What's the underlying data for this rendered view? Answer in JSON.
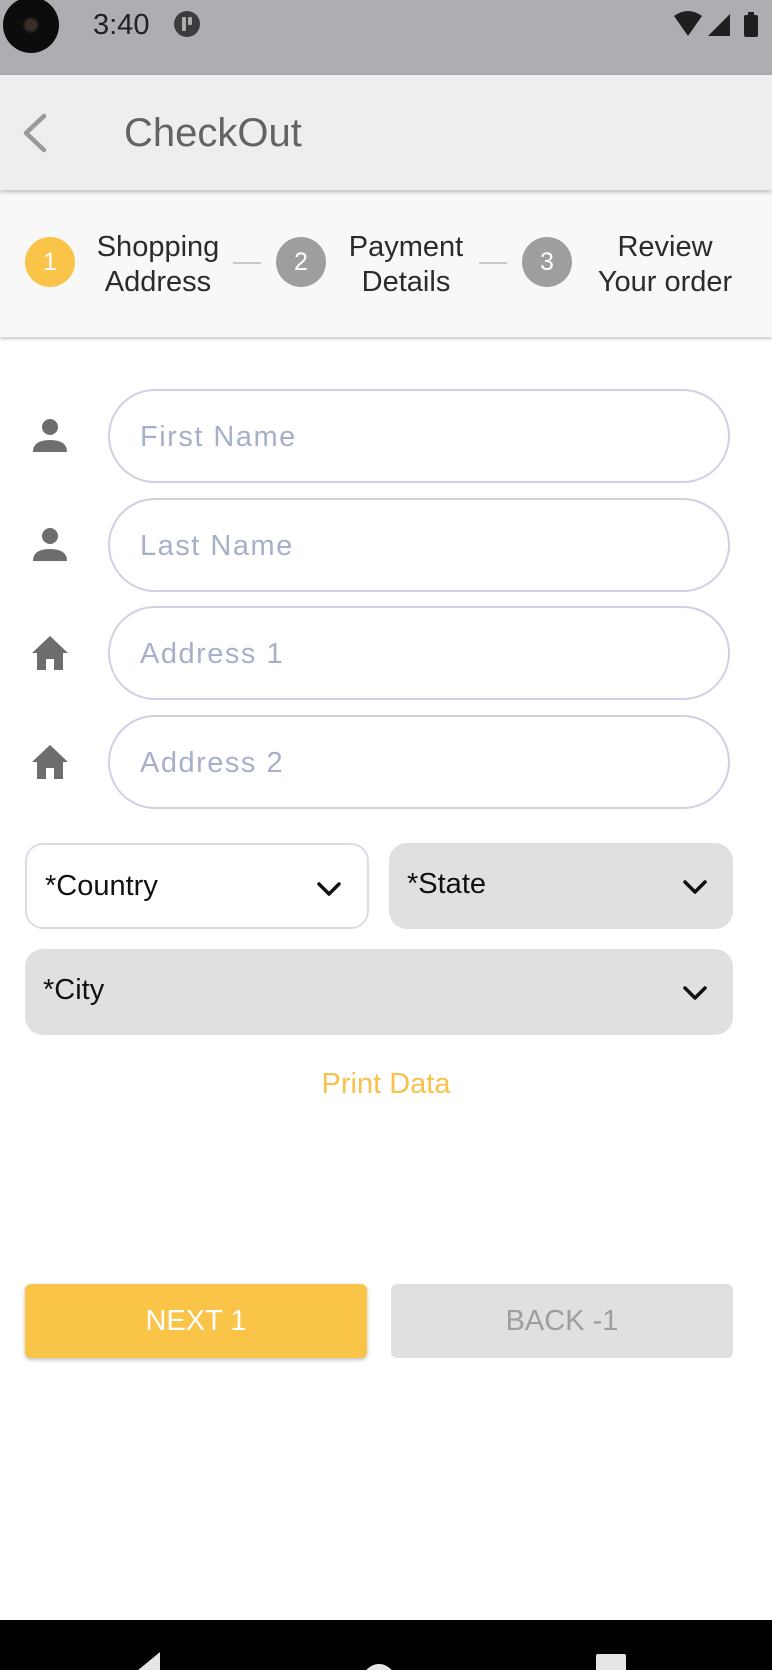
{
  "status_bar": {
    "time": "3:40",
    "icons": [
      "camera-dot-icon",
      "app-notification-icon",
      "wifi-icon",
      "cell-signal-icon",
      "battery-icon"
    ]
  },
  "app_bar": {
    "title": "CheckOut",
    "back_icon": "chevron-left-icon"
  },
  "stepper": {
    "steps": [
      {
        "number": "1",
        "label": "Shopping\nAddress",
        "state": "active"
      },
      {
        "number": "2",
        "label": "Payment\nDetails",
        "state": "inactive"
      },
      {
        "number": "3",
        "label": "Review\nYour order",
        "state": "inactive"
      }
    ]
  },
  "form": {
    "first_name": {
      "placeholder": "First Name",
      "value": "",
      "icon": "person-icon"
    },
    "last_name": {
      "placeholder": "Last Name",
      "value": "",
      "icon": "person-icon"
    },
    "address1": {
      "placeholder": "Address 1",
      "value": "",
      "icon": "home-icon"
    },
    "address2": {
      "placeholder": "Address 2",
      "value": "",
      "icon": "home-icon"
    },
    "country": {
      "label": "*Country",
      "enabled": true
    },
    "state": {
      "label": "*State",
      "enabled": false
    },
    "city": {
      "label": "*City",
      "enabled": false
    }
  },
  "print_data_label": "Print Data",
  "buttons": {
    "next_label": "NEXT 1",
    "back_label": "BACK -1"
  },
  "colors": {
    "accent": "#f9c448",
    "inactive_step": "#9e9e9e",
    "field_border": "#d0d0e4",
    "placeholder": "#a7b0c8",
    "disabled_bg": "#e0e0e0"
  }
}
